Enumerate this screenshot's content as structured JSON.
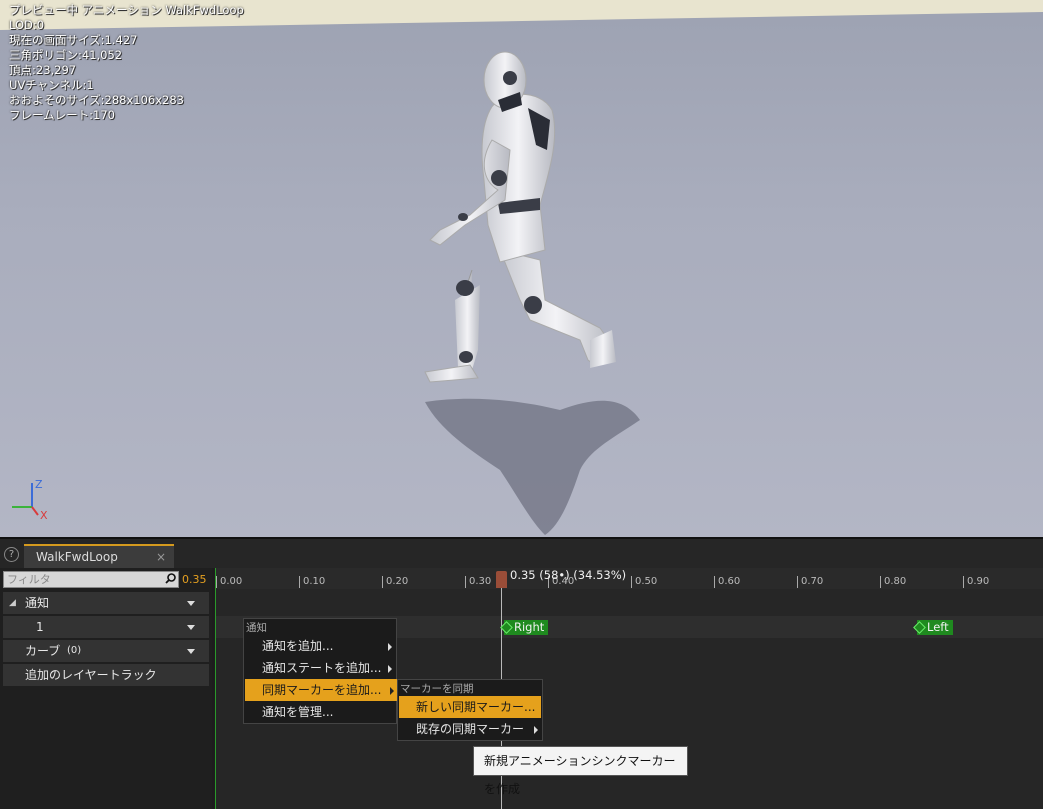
{
  "viewport": {
    "stats": [
      "プレビュー中 アニメーション WalkFwdLoop",
      "LOD:0",
      "現在の画面サイズ:1.427",
      "三角ポリゴン:41,052",
      "頂点:23,297",
      "UVチャンネル:1",
      "おおよそのサイズ:288x106x283",
      "フレームレート:170"
    ],
    "axis_z": "Z",
    "axis_x": "X"
  },
  "panel": {
    "tab_title": "WalkFwdLoop",
    "tab_close": "×",
    "help": "?",
    "filter_placeholder": "フィルタ",
    "current_time": "0.35",
    "tracks": {
      "notifies": "通知",
      "notify_track_1": "1",
      "curves": "カーブ",
      "curves_count": "(0)",
      "additive_layer": "追加のレイヤートラック"
    },
    "ruler_ticks": [
      "0.00",
      "0.10",
      "0.20",
      "0.30",
      "0.40",
      "0.50",
      "0.60",
      "0.70",
      "0.80",
      "0.90"
    ],
    "scrub_label": "0.35 (58•) (34.53%)",
    "markers": {
      "right": "Right",
      "left": "Left"
    }
  },
  "context_menu": {
    "header": "通知",
    "items": [
      "通知を追加...",
      "通知ステートを追加...",
      "同期マーカーを追加...",
      "通知を管理..."
    ]
  },
  "submenu": {
    "header": "マーカーを同期",
    "items": [
      "新しい同期マーカー...",
      "既存の同期マーカー"
    ]
  },
  "tooltip": "新規アニメーションシンクマーカーを作成"
}
